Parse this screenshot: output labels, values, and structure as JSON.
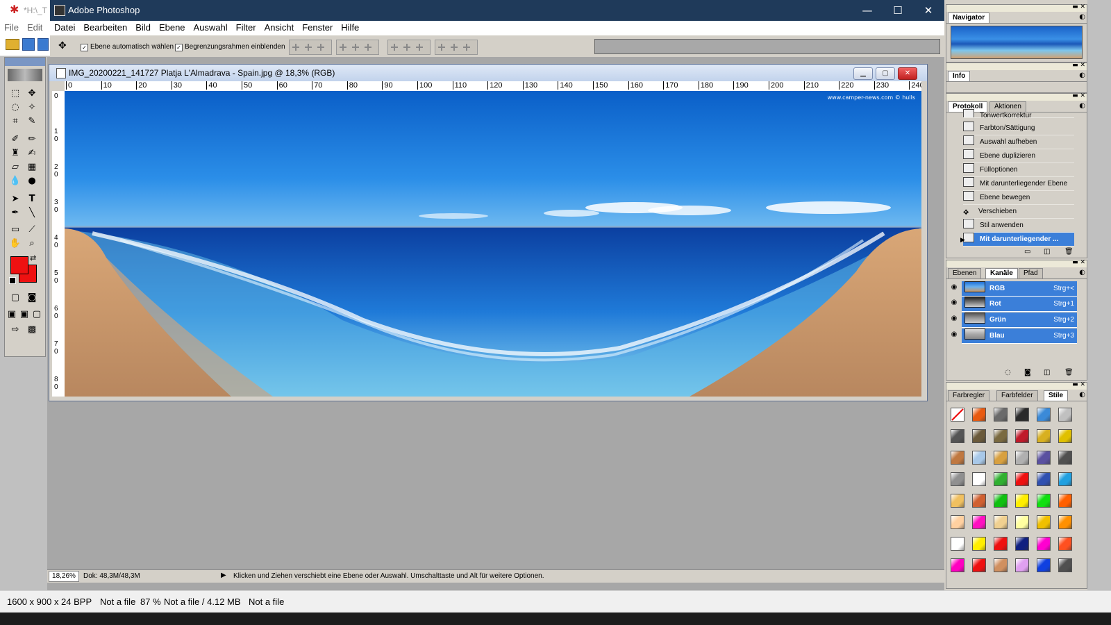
{
  "outer_app": {
    "title": "*H:\\_T",
    "menu": [
      "File",
      "Edit"
    ],
    "status": {
      "dimensions": "1600 x 900 x 24 BPP",
      "file1": "Not a file",
      "zoom": "87 %",
      "file_size": "Not a file / 4.12 MB",
      "file2": "Not a file"
    }
  },
  "window": {
    "title": "Adobe Photoshop",
    "controls": {
      "minimize": "—",
      "maximize": "☐",
      "close": "✕"
    }
  },
  "menubar": [
    "Datei",
    "Bearbeiten",
    "Bild",
    "Ebene",
    "Auswahl",
    "Filter",
    "Ansicht",
    "Fenster",
    "Hilfe"
  ],
  "options": {
    "auto_select": "Ebene automatisch wählen",
    "auto_select_checked": true,
    "show_bounds": "Begrenzungsrahmen einblenden",
    "show_bounds_checked": true
  },
  "document": {
    "title": "IMG_20200221_141727 Platja L'Almadrava - Spain.jpg @ 18,3% (RGB)",
    "watermark": "www.camper-news.com © hulls",
    "ruler_top": [
      "0",
      "10",
      "20",
      "30",
      "40",
      "50",
      "60",
      "70",
      "80",
      "90",
      "100",
      "110",
      "120",
      "130",
      "140",
      "150",
      "160",
      "170",
      "180",
      "190",
      "200",
      "210",
      "220",
      "230",
      "240"
    ],
    "ruler_left": [
      "0",
      "1 0",
      "2 0",
      "3 0",
      "4 0",
      "5 0",
      "6 0",
      "7 0",
      "8 0"
    ]
  },
  "statusbar": {
    "zoom": "18,26%",
    "doc": "Dok: 48,3M/48,3M",
    "hint": "Klicken und Ziehen verschiebt eine Ebene oder Auswahl. Umschalttaste und Alt für weitere Optionen."
  },
  "palettes": {
    "navigator": {
      "tab": "Navigator"
    },
    "info": {
      "tab": "Info"
    },
    "history": {
      "tabs": [
        "Protokoll",
        "Aktionen"
      ],
      "items": [
        {
          "label": "Tonwertkorrektur",
          "selected": false
        },
        {
          "label": "Farbton/Sättigung",
          "selected": false
        },
        {
          "label": "Auswahl aufheben",
          "selected": false
        },
        {
          "label": "Ebene duplizieren",
          "selected": false
        },
        {
          "label": "Fülloptionen",
          "selected": false
        },
        {
          "label": "Mit darunterliegender Ebene ...",
          "selected": false
        },
        {
          "label": "Ebene bewegen",
          "selected": false
        },
        {
          "label": "Verschieben",
          "selected": false
        },
        {
          "label": "Stil anwenden",
          "selected": false
        },
        {
          "label": "Mit darunterliegender ...",
          "selected": true
        }
      ]
    },
    "channels": {
      "tabs": [
        "Ebenen",
        "Kanäle",
        "Pfad"
      ],
      "items": [
        {
          "name": "RGB",
          "shortcut": "Strg+<"
        },
        {
          "name": "Rot",
          "shortcut": "Strg+1"
        },
        {
          "name": "Grün",
          "shortcut": "Strg+2"
        },
        {
          "name": "Blau",
          "shortcut": "Strg+3"
        }
      ]
    },
    "styles": {
      "tabs": [
        "Farbregler",
        "Farbfelder",
        "Stile"
      ],
      "swatch_colors": [
        "#ffffff",
        "#e85a10",
        "#6a6a6a",
        "#2a2a2a",
        "#3b8ad8",
        "#c0c0c0",
        "#555555",
        "#6b5a3a",
        "#7a6a40",
        "#c01a2a",
        "#d8b020",
        "#e0c000",
        "#c07840",
        "#a8c8e8",
        "#d8a040",
        "#b0b0b0",
        "#5a50a0",
        "#505050",
        "#909090",
        "#ffffff",
        "#30b030",
        "#ee1010",
        "#3050b0",
        "#20a0e0",
        "#f0c060",
        "#d06030",
        "#10c010",
        "#ffee00",
        "#10e010",
        "#ff6000",
        "#ffd0a0",
        "#ff10c0",
        "#f0d090",
        "#ffffa0",
        "#f0c000",
        "#ff9000",
        "#ffffff",
        "#ffee00",
        "#ee1010",
        "#102080",
        "#ff00d0",
        "#ff5020",
        "#ff00c0",
        "#ee1010",
        "#d09060",
        "#e0a0f0",
        "#1040e0",
        "#505050"
      ]
    }
  },
  "colors": {
    "foreground": "#ee1111",
    "background": "#ee1111",
    "selection": "#3b7fd9",
    "titlebar": "#1f3a5a"
  }
}
